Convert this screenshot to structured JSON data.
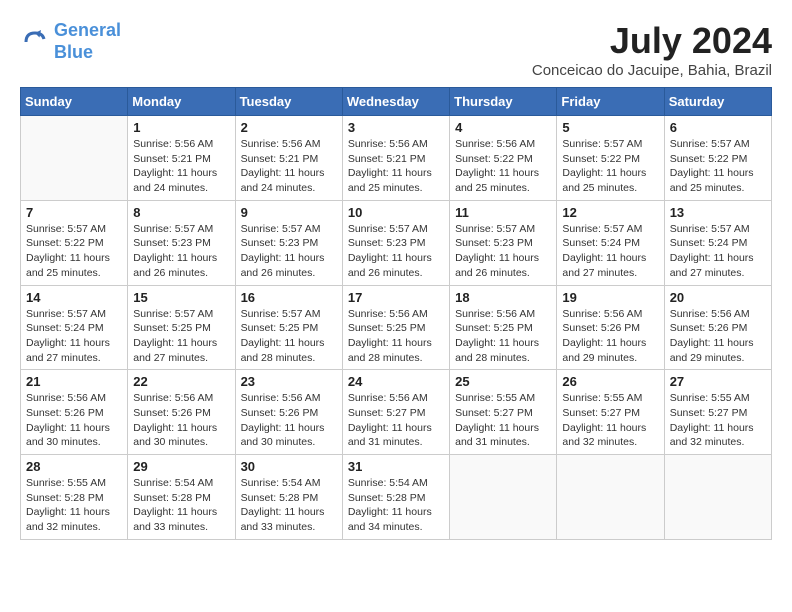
{
  "header": {
    "logo_line1": "General",
    "logo_line2": "Blue",
    "month_year": "July 2024",
    "location": "Conceicao do Jacuipe, Bahia, Brazil"
  },
  "weekdays": [
    "Sunday",
    "Monday",
    "Tuesday",
    "Wednesday",
    "Thursday",
    "Friday",
    "Saturday"
  ],
  "weeks": [
    [
      {
        "day": null
      },
      {
        "day": 1,
        "sunrise": "5:56 AM",
        "sunset": "5:21 PM",
        "daylight": "11 hours and 24 minutes."
      },
      {
        "day": 2,
        "sunrise": "5:56 AM",
        "sunset": "5:21 PM",
        "daylight": "11 hours and 24 minutes."
      },
      {
        "day": 3,
        "sunrise": "5:56 AM",
        "sunset": "5:21 PM",
        "daylight": "11 hours and 25 minutes."
      },
      {
        "day": 4,
        "sunrise": "5:56 AM",
        "sunset": "5:22 PM",
        "daylight": "11 hours and 25 minutes."
      },
      {
        "day": 5,
        "sunrise": "5:57 AM",
        "sunset": "5:22 PM",
        "daylight": "11 hours and 25 minutes."
      },
      {
        "day": 6,
        "sunrise": "5:57 AM",
        "sunset": "5:22 PM",
        "daylight": "11 hours and 25 minutes."
      }
    ],
    [
      {
        "day": 7,
        "sunrise": "5:57 AM",
        "sunset": "5:22 PM",
        "daylight": "11 hours and 25 minutes."
      },
      {
        "day": 8,
        "sunrise": "5:57 AM",
        "sunset": "5:23 PM",
        "daylight": "11 hours and 26 minutes."
      },
      {
        "day": 9,
        "sunrise": "5:57 AM",
        "sunset": "5:23 PM",
        "daylight": "11 hours and 26 minutes."
      },
      {
        "day": 10,
        "sunrise": "5:57 AM",
        "sunset": "5:23 PM",
        "daylight": "11 hours and 26 minutes."
      },
      {
        "day": 11,
        "sunrise": "5:57 AM",
        "sunset": "5:23 PM",
        "daylight": "11 hours and 26 minutes."
      },
      {
        "day": 12,
        "sunrise": "5:57 AM",
        "sunset": "5:24 PM",
        "daylight": "11 hours and 27 minutes."
      },
      {
        "day": 13,
        "sunrise": "5:57 AM",
        "sunset": "5:24 PM",
        "daylight": "11 hours and 27 minutes."
      }
    ],
    [
      {
        "day": 14,
        "sunrise": "5:57 AM",
        "sunset": "5:24 PM",
        "daylight": "11 hours and 27 minutes."
      },
      {
        "day": 15,
        "sunrise": "5:57 AM",
        "sunset": "5:25 PM",
        "daylight": "11 hours and 27 minutes."
      },
      {
        "day": 16,
        "sunrise": "5:57 AM",
        "sunset": "5:25 PM",
        "daylight": "11 hours and 28 minutes."
      },
      {
        "day": 17,
        "sunrise": "5:56 AM",
        "sunset": "5:25 PM",
        "daylight": "11 hours and 28 minutes."
      },
      {
        "day": 18,
        "sunrise": "5:56 AM",
        "sunset": "5:25 PM",
        "daylight": "11 hours and 28 minutes."
      },
      {
        "day": 19,
        "sunrise": "5:56 AM",
        "sunset": "5:26 PM",
        "daylight": "11 hours and 29 minutes."
      },
      {
        "day": 20,
        "sunrise": "5:56 AM",
        "sunset": "5:26 PM",
        "daylight": "11 hours and 29 minutes."
      }
    ],
    [
      {
        "day": 21,
        "sunrise": "5:56 AM",
        "sunset": "5:26 PM",
        "daylight": "11 hours and 30 minutes."
      },
      {
        "day": 22,
        "sunrise": "5:56 AM",
        "sunset": "5:26 PM",
        "daylight": "11 hours and 30 minutes."
      },
      {
        "day": 23,
        "sunrise": "5:56 AM",
        "sunset": "5:26 PM",
        "daylight": "11 hours and 30 minutes."
      },
      {
        "day": 24,
        "sunrise": "5:56 AM",
        "sunset": "5:27 PM",
        "daylight": "11 hours and 31 minutes."
      },
      {
        "day": 25,
        "sunrise": "5:55 AM",
        "sunset": "5:27 PM",
        "daylight": "11 hours and 31 minutes."
      },
      {
        "day": 26,
        "sunrise": "5:55 AM",
        "sunset": "5:27 PM",
        "daylight": "11 hours and 32 minutes."
      },
      {
        "day": 27,
        "sunrise": "5:55 AM",
        "sunset": "5:27 PM",
        "daylight": "11 hours and 32 minutes."
      }
    ],
    [
      {
        "day": 28,
        "sunrise": "5:55 AM",
        "sunset": "5:28 PM",
        "daylight": "11 hours and 32 minutes."
      },
      {
        "day": 29,
        "sunrise": "5:54 AM",
        "sunset": "5:28 PM",
        "daylight": "11 hours and 33 minutes."
      },
      {
        "day": 30,
        "sunrise": "5:54 AM",
        "sunset": "5:28 PM",
        "daylight": "11 hours and 33 minutes."
      },
      {
        "day": 31,
        "sunrise": "5:54 AM",
        "sunset": "5:28 PM",
        "daylight": "11 hours and 34 minutes."
      },
      {
        "day": null
      },
      {
        "day": null
      },
      {
        "day": null
      }
    ]
  ]
}
